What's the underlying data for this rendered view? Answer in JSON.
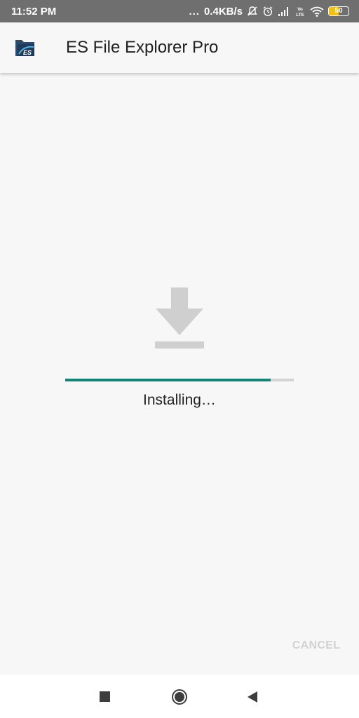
{
  "status_bar": {
    "time": "11:52 PM",
    "dots": "...",
    "net_speed": "0.4KB/s",
    "battery_level": "50",
    "battery_fraction": 0.5,
    "icons": [
      "mute-icon",
      "alarm-icon",
      "signal-icon",
      "volte-icon",
      "wifi-icon",
      "battery-icon"
    ]
  },
  "app_bar": {
    "title": "ES File Explorer Pro",
    "icon": "es-file-explorer-app-icon"
  },
  "install": {
    "icon": "download-icon",
    "progress": 0.9,
    "status": "Installing…",
    "cancel_label": "CANCEL"
  },
  "nav_bar": {
    "icons": [
      "recents-square-icon",
      "home-circle-icon",
      "back-triangle-icon"
    ]
  },
  "colors": {
    "accent": "#128577",
    "icon_gray": "#cfcfcf",
    "disabled_text": "#d2d2d2",
    "status_bar": "#6f6f6f"
  }
}
